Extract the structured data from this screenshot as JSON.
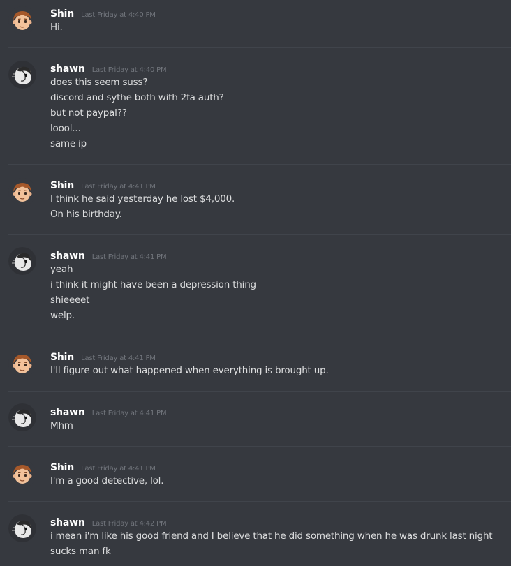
{
  "messages": [
    {
      "author": "Shin",
      "avatar": "shin-avatar-icon",
      "timestamp": "Last Friday at 4:40 PM",
      "lines": [
        "Hi."
      ]
    },
    {
      "author": "shawn",
      "avatar": "shawn-avatar-icon",
      "timestamp": "Last Friday at 4:40 PM",
      "lines": [
        "does this seem suss?",
        "discord and sythe both with 2fa auth?",
        "but not paypal??",
        "loool...",
        "same ip"
      ]
    },
    {
      "author": "Shin",
      "avatar": "shin-avatar-icon",
      "timestamp": "Last Friday at 4:41 PM",
      "lines": [
        "I think he said yesterday he lost $4,000.",
        "On his birthday."
      ]
    },
    {
      "author": "shawn",
      "avatar": "shawn-avatar-icon",
      "timestamp": "Last Friday at 4:41 PM",
      "lines": [
        "yeah",
        "i think it might have been a depression thing",
        "shieeeet",
        "welp."
      ]
    },
    {
      "author": "Shin",
      "avatar": "shin-avatar-icon",
      "timestamp": "Last Friday at 4:41 PM",
      "lines": [
        "I'll figure out what happened when everything is brought up."
      ]
    },
    {
      "author": "shawn",
      "avatar": "shawn-avatar-icon",
      "timestamp": "Last Friday at 4:41 PM",
      "lines": [
        "Mhm"
      ]
    },
    {
      "author": "Shin",
      "avatar": "shin-avatar-icon",
      "timestamp": "Last Friday at 4:41 PM",
      "lines": [
        "I'm a good detective, lol."
      ]
    },
    {
      "author": "shawn",
      "avatar": "shawn-avatar-icon",
      "timestamp": "Last Friday at 4:42 PM",
      "lines": [
        "i mean i'm like his good friend and I believe that he did something when he was drunk last night",
        "sucks man fk"
      ]
    }
  ],
  "colors": {
    "background": "#36393f",
    "divider": "#40444b",
    "username": "#ffffff",
    "timestamp": "#72767d",
    "text": "#dcddde"
  }
}
